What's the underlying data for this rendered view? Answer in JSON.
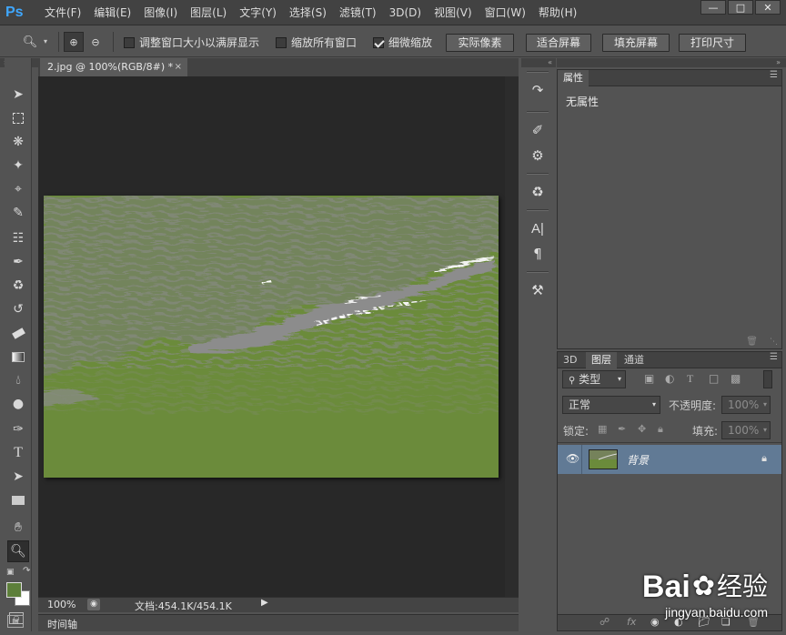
{
  "app": {
    "logo": "Ps"
  },
  "menu": [
    "文件(F)",
    "编辑(E)",
    "图像(I)",
    "图层(L)",
    "文字(Y)",
    "选择(S)",
    "滤镜(T)",
    "3D(D)",
    "视图(V)",
    "窗口(W)",
    "帮助(H)"
  ],
  "options": {
    "resize_window": "调整窗口大小以满屏显示",
    "zoom_all_windows": "缩放所有窗口",
    "scrubby_zoom": "细微缩放",
    "scrubby_zoom_checked": true,
    "resize_window_checked": false,
    "zoom_all_checked": false,
    "actual_pixels": "实际像素",
    "fit_screen": "适合屏幕",
    "fill_screen": "填充屏幕",
    "print_size": "打印尺寸"
  },
  "document": {
    "tab_title": "2.jpg @ 100%(RGB/8#) *",
    "zoom": "100%",
    "doc_info": "文档:454.1K/454.1K"
  },
  "timeline": {
    "label": "时间轴"
  },
  "properties": {
    "tab": "属性",
    "content": "无属性"
  },
  "layers_panel": {
    "tabs": [
      "3D",
      "图层",
      "通道"
    ],
    "active_tab": "图层",
    "filter": "类型",
    "blend_mode": "正常",
    "opacity_label": "不透明度:",
    "opacity_value": "100%",
    "lock_label": "锁定:",
    "fill_label": "填充:",
    "fill_value": "100%",
    "layers": [
      {
        "name": "背景",
        "visible": true,
        "locked": true
      }
    ]
  },
  "watermark": {
    "brand": "Bai",
    "brand_cn": "经验",
    "url": "jingyan.baidu.com"
  },
  "colors": {
    "foreground": "#5d7f3a",
    "background": "#ffffff",
    "image_green": "#6a8a3a",
    "selected_layer": "#617a95"
  }
}
